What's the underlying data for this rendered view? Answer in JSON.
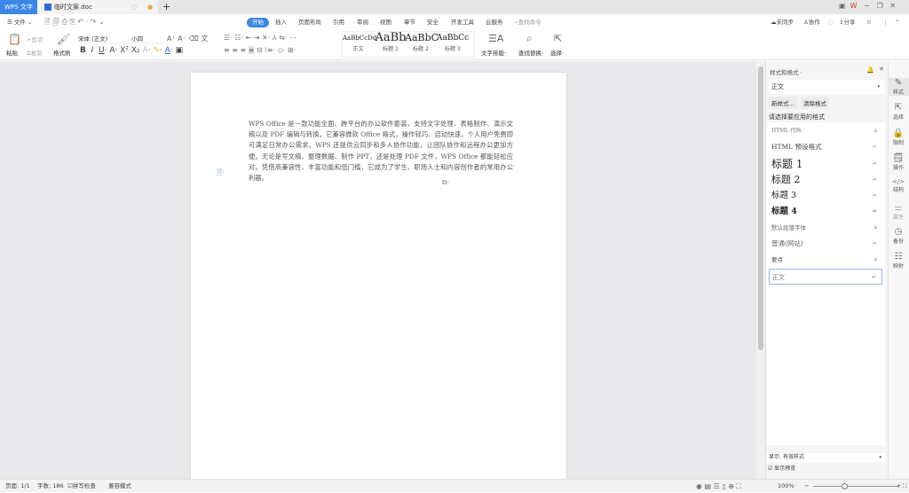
{
  "titlebar": {
    "app_tab": "WPS 文字",
    "doc_tab": "临时文案.doc",
    "new_tab": "+"
  },
  "menu": {
    "file": "文件",
    "tabs": [
      "开始",
      "插入",
      "页面布局",
      "引用",
      "审阅",
      "视图",
      "章节",
      "安全",
      "开发工具",
      "云服务"
    ],
    "search": "查找命令",
    "sync": "未同步",
    "collab": "协作",
    "share": "分享"
  },
  "toolbar": {
    "paste": "粘贴",
    "cut": "剪切",
    "copy": "复制",
    "format_painter": "格式刷",
    "font": "宋体 (正文)",
    "size": "小四",
    "styles": [
      {
        "preview": "AaBbCcDd",
        "label": "正文"
      },
      {
        "preview": "AaBb",
        "label": "标题 1"
      },
      {
        "preview": "AaBbC",
        "label": "标题 2"
      },
      {
        "preview": "AaBbCcI",
        "label": "标题 3"
      }
    ],
    "text_layout": "文字排版",
    "find_replace": "查找替换",
    "select": "选择"
  },
  "document": {
    "text": "WPS Office 是一款功能全面、跨平台的办公软件套装，支持文字处理、表格制作、演示文稿以及 PDF 编辑与转换。它兼容微软 Office 格式，操作轻巧、启动快速，个人用户免费即可满足日常办公需求。WPS 还提供云同步和多人协作功能，让团队协作和远程办公更加方便。无论是写文稿、整理数据、制作 PPT，还是处理 PDF 文件，WPS Office 都能轻松应对。凭借高兼容性、丰富功能和低门槛，它成为了学生、职场人士和内容创作者的常用办公利器。"
  },
  "panel": {
    "title": "样式和格式",
    "current": "正文",
    "new_style": "新样式...",
    "clear_format": "清除格式",
    "prompt": "请选择要应用的格式",
    "items": [
      {
        "label": "HTML 代码",
        "mark": "a"
      },
      {
        "label": "HTML 预设格式",
        "mark": "↵"
      },
      {
        "label": "标题 1",
        "mark": "↵"
      },
      {
        "label": "标题 2",
        "mark": "↵"
      },
      {
        "label": "标题 3",
        "mark": "↵"
      },
      {
        "label": "标题 4",
        "mark": "↵"
      },
      {
        "label": "默认段落字体",
        "mark": "a"
      },
      {
        "label": "普通(网站)",
        "mark": "↵"
      },
      {
        "label": "要点",
        "mark": "a"
      },
      {
        "label": "正文",
        "mark": "↵"
      }
    ],
    "show_label": "显示:",
    "show_value": "有效样式",
    "preview_label": "显示预览"
  },
  "side": [
    "样式",
    "选择",
    "限制",
    "操作",
    "结构",
    "属性",
    "备份",
    "映射"
  ],
  "status": {
    "page": "页面: 1/1",
    "words": "字数: 186",
    "spell": "拼写检查",
    "compat": "兼容模式",
    "zoom": "100%"
  }
}
